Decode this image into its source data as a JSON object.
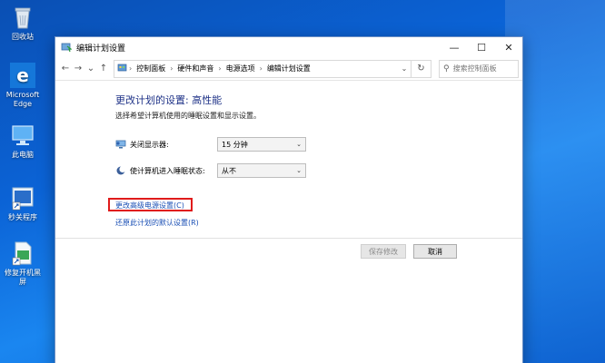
{
  "desktop": {
    "icons": [
      {
        "label": "回收站"
      },
      {
        "label": "Microsoft Edge"
      },
      {
        "label": "此电脑"
      },
      {
        "label": "秒关程序"
      },
      {
        "label": "修复开机黑屏"
      }
    ]
  },
  "window": {
    "title": "编辑计划设置",
    "minimize_glyph": "—",
    "maximize_glyph": "☐",
    "close_glyph": "✕"
  },
  "nav": {
    "back_glyph": "←",
    "forward_glyph": "→",
    "down_glyph": "⌄",
    "up_glyph": "↑",
    "breadcrumbs": [
      "控制面板",
      "硬件和声音",
      "电源选项",
      "编辑计划设置"
    ],
    "search_placeholder": "搜索控制面板",
    "refresh_glyph": "↻"
  },
  "main": {
    "heading": "更改计划的设置: 高性能",
    "subtitle": "选择希望计算机使用的睡眠设置和显示设置。",
    "settings": [
      {
        "label": "关闭显示器:",
        "value": "15 分钟"
      },
      {
        "label": "使计算机进入睡眠状态:",
        "value": "从不"
      }
    ],
    "links": [
      {
        "label": "更改高级电源设置(C)"
      },
      {
        "label": "还原此计划的默认设置(R)"
      }
    ],
    "save_label": "保存修改",
    "cancel_label": "取消"
  },
  "colors": {
    "heading": "#1e3287",
    "link": "#1a4fb5",
    "highlight_box": "#e01b1b"
  }
}
